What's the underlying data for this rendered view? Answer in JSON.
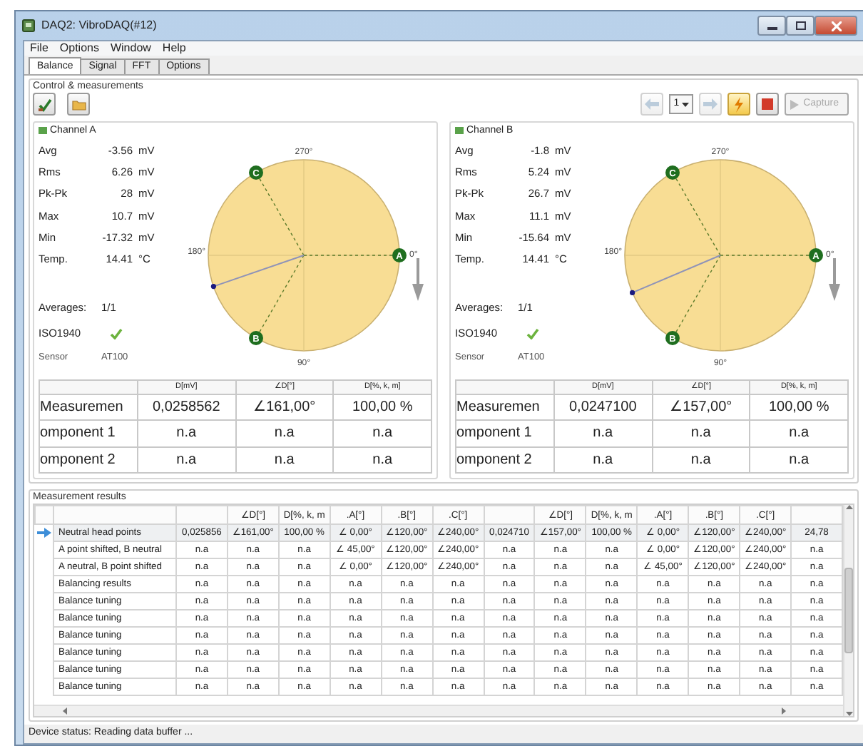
{
  "window": {
    "title": "DAQ2: VibroDAQ(#12)"
  },
  "menu": [
    "File",
    "Options",
    "Window",
    "Help"
  ],
  "tabs": [
    {
      "label": "Balance",
      "selected": true
    },
    {
      "label": "Signal",
      "selected": false
    },
    {
      "label": "FFT",
      "selected": false
    },
    {
      "label": "Options",
      "selected": false
    }
  ],
  "control_group": {
    "title": "Control & measurements",
    "toolbar": [
      {
        "kind": "prev",
        "disabled": true
      },
      {
        "kind": "select",
        "value": "1"
      },
      {
        "kind": "next",
        "disabled": true
      },
      {
        "kind": "trigger",
        "disabled": false
      },
      {
        "kind": "stop",
        "disabled": false
      },
      {
        "kind": "capture",
        "label": "Capture",
        "disabled": true
      }
    ]
  },
  "channels": [
    {
      "title": "Channel A",
      "stats": [
        {
          "label": "Avg",
          "value": "-3.56",
          "unit": "mV"
        },
        {
          "label": "Rms",
          "value": "6.26",
          "unit": "mV"
        },
        {
          "label": "Pk-Pk",
          "value": "28",
          "unit": "mV"
        },
        {
          "label": "Max",
          "value": "10.7",
          "unit": "mV"
        },
        {
          "label": "Min",
          "value": "-17.32",
          "unit": "mV"
        },
        {
          "label": "Temp.",
          "value": "14.41",
          "unit": "°C"
        }
      ],
      "averages_label": "Averages:",
      "averages": "1/1",
      "iso_label": "ISO1940",
      "iso_ok": true,
      "sensor_label": "Sensor",
      "sensor": "AT100",
      "polar": {
        "top": "270°",
        "bottom": "90°",
        "left": "180°",
        "right": "0°",
        "points": [
          "A",
          "B",
          "C"
        ]
      },
      "table": {
        "columns": [
          "D[mV]",
          "∠D[°]",
          "D[%, k, m]"
        ],
        "rows": [
          {
            "label": "Measuremen",
            "cells": [
              "0,0258562",
              "∠161,00°",
              "100,00 %"
            ]
          },
          {
            "label": "omponent 1",
            "cells": [
              "n.a",
              "n.a",
              "n.a"
            ]
          },
          {
            "label": "omponent 2",
            "cells": [
              "n.a",
              "n.a",
              "n.a"
            ]
          }
        ]
      }
    },
    {
      "title": "Channel B",
      "stats": [
        {
          "label": "Avg",
          "value": "-1.8",
          "unit": "mV"
        },
        {
          "label": "Rms",
          "value": "5.24",
          "unit": "mV"
        },
        {
          "label": "Pk-Pk",
          "value": "26.7",
          "unit": "mV"
        },
        {
          "label": "Max",
          "value": "11.1",
          "unit": "mV"
        },
        {
          "label": "Min",
          "value": "-15.64",
          "unit": "mV"
        },
        {
          "label": "Temp.",
          "value": "14.41",
          "unit": "°C"
        }
      ],
      "averages_label": "Averages:",
      "averages": "1/1",
      "iso_label": "ISO1940",
      "iso_ok": true,
      "sensor_label": "Sensor",
      "sensor": "AT100",
      "polar": {
        "top": "270°",
        "bottom": "90°",
        "left": "180°",
        "right": "0°",
        "points": [
          "A",
          "B",
          "C"
        ]
      },
      "table": {
        "columns": [
          "D[mV]",
          "∠D[°]",
          "D[%, k, m]"
        ],
        "rows": [
          {
            "label": "Measuremen",
            "cells": [
              "0,0247100",
              "∠157,00°",
              "100,00 %"
            ]
          },
          {
            "label": "omponent 1",
            "cells": [
              "n.a",
              "n.a",
              "n.a"
            ]
          },
          {
            "label": "omponent 2",
            "cells": [
              "n.a",
              "n.a",
              "n.a"
            ]
          }
        ]
      }
    }
  ],
  "results": {
    "title": "Measurement results",
    "columns": [
      {},
      {
        "label": "∠D[°]"
      },
      {
        "label": "D[%, k, m"
      },
      {
        "label": ".A[°]"
      },
      {
        "label": ".B[°]"
      },
      {
        "label": ".C[°]"
      },
      {},
      {
        "label": "∠D[°]"
      },
      {
        "label": "D[%, k, m"
      },
      {
        "label": ".A[°]"
      },
      {
        "label": ".B[°]"
      },
      {
        "label": ".C[°]"
      },
      {}
    ],
    "rows": [
      {
        "label": "Neutral head points",
        "selected": true,
        "cells": [
          "0,025856",
          "∠161,00°",
          "100,00 %",
          "∠ 0,00°",
          "∠120,00°",
          "∠240,00°",
          "0,024710",
          "∠157,00°",
          "100,00 %",
          "∠ 0,00°",
          "∠120,00°",
          "∠240,00°",
          "24,78"
        ]
      },
      {
        "label": "A point shifted, B neutral",
        "selected": false,
        "cells": [
          "n.a",
          "n.a",
          "n.a",
          "∠ 45,00°",
          "∠120,00°",
          "∠240,00°",
          "n.a",
          "n.a",
          "n.a",
          "∠ 0,00°",
          "∠120,00°",
          "∠240,00°",
          "n.a"
        ]
      },
      {
        "label": "A neutral, B point shifted",
        "selected": false,
        "cells": [
          "n.a",
          "n.a",
          "n.a",
          "∠ 0,00°",
          "∠120,00°",
          "∠240,00°",
          "n.a",
          "n.a",
          "n.a",
          "∠ 45,00°",
          "∠120,00°",
          "∠240,00°",
          "n.a"
        ]
      },
      {
        "label": "Balancing results",
        "selected": false,
        "cells": [
          "n.a",
          "n.a",
          "n.a",
          "n.a",
          "n.a",
          "n.a",
          "n.a",
          "n.a",
          "n.a",
          "n.a",
          "n.a",
          "n.a",
          "n.a"
        ]
      },
      {
        "label": "Balance tuning",
        "selected": false,
        "cells": [
          "n.a",
          "n.a",
          "n.a",
          "n.a",
          "n.a",
          "n.a",
          "n.a",
          "n.a",
          "n.a",
          "n.a",
          "n.a",
          "n.a",
          "n.a"
        ]
      },
      {
        "label": "Balance tuning",
        "selected": false,
        "cells": [
          "n.a",
          "n.a",
          "n.a",
          "n.a",
          "n.a",
          "n.a",
          "n.a",
          "n.a",
          "n.a",
          "n.a",
          "n.a",
          "n.a",
          "n.a"
        ]
      },
      {
        "label": "Balance tuning",
        "selected": false,
        "cells": [
          "n.a",
          "n.a",
          "n.a",
          "n.a",
          "n.a",
          "n.a",
          "n.a",
          "n.a",
          "n.a",
          "n.a",
          "n.a",
          "n.a",
          "n.a"
        ]
      },
      {
        "label": "Balance tuning",
        "selected": false,
        "cells": [
          "n.a",
          "n.a",
          "n.a",
          "n.a",
          "n.a",
          "n.a",
          "n.a",
          "n.a",
          "n.a",
          "n.a",
          "n.a",
          "n.a",
          "n.a"
        ]
      },
      {
        "label": "Balance tuning",
        "selected": false,
        "cells": [
          "n.a",
          "n.a",
          "n.a",
          "n.a",
          "n.a",
          "n.a",
          "n.a",
          "n.a",
          "n.a",
          "n.a",
          "n.a",
          "n.a",
          "n.a"
        ]
      },
      {
        "label": "Balance tuning",
        "selected": false,
        "cells": [
          "n.a",
          "n.a",
          "n.a",
          "n.a",
          "n.a",
          "n.a",
          "n.a",
          "n.a",
          "n.a",
          "n.a",
          "n.a",
          "n.a",
          "n.a"
        ]
      }
    ]
  },
  "status_bar": "Device status: Reading data buffer ..."
}
